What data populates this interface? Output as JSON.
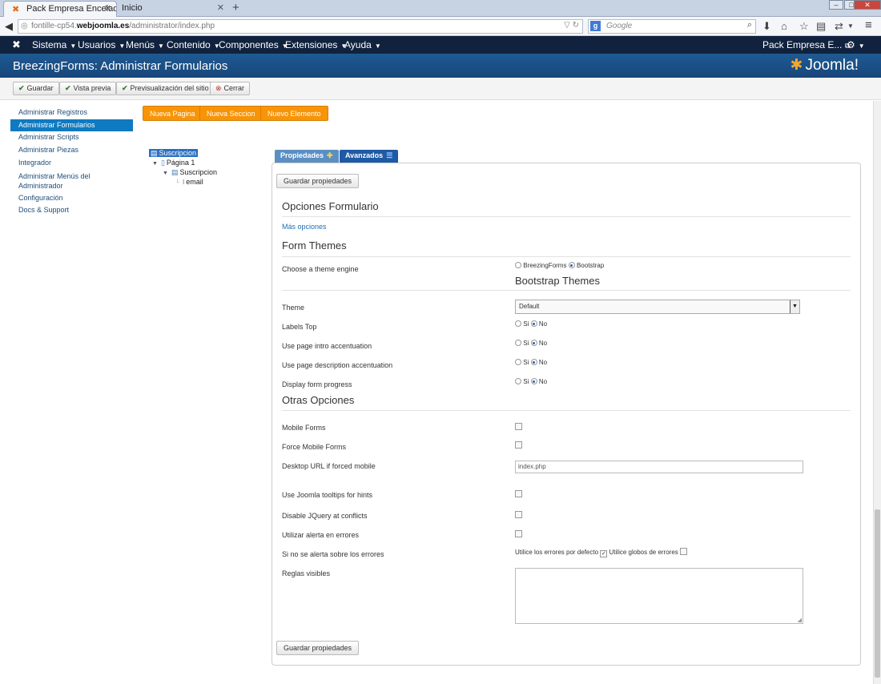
{
  "browser": {
    "tabs": [
      {
        "title": "Pack Empresa Encelado - A...",
        "active": true
      },
      {
        "title": "Inicio",
        "active": false
      }
    ],
    "new_tab": "+",
    "url_prefix": "fontille-cp54.",
    "url_domain": "webjoomla.es",
    "url_suffix": "/administrator/index.php",
    "search_placeholder": "Google",
    "search_engine_letter": "g"
  },
  "joomla_menu": {
    "items": [
      "Sistema",
      "Usuarios",
      "Menús",
      "Contenido",
      "Componentes",
      "Extensiones",
      "Ayuda"
    ],
    "site_link": "Pack Empresa E...",
    "gear": "⚙"
  },
  "header": {
    "title": "BreezingForms: Administrar Formularios",
    "brand": "Joomla!"
  },
  "toolbar": {
    "save": "Guardar",
    "preview": "Vista previa",
    "site_preview": "Previsualización del sitio",
    "close": "Cerrar"
  },
  "sidebar": {
    "items": [
      "Administrar Registros",
      "Administrar Formularios",
      "Administrar Scripts",
      "Administrar Piezas",
      "Integrador",
      "Administrar Menús del Administrador",
      "Configuración",
      "Docs & Support"
    ],
    "active_index": 1
  },
  "actions": {
    "new_page": "Nueva Pagina",
    "new_section": "Nueva Seccion",
    "new_element": "Nuevo Elemento"
  },
  "tree": {
    "root": "Suscripcion",
    "page": "Página 1",
    "section": "Suscripcion",
    "element": "email"
  },
  "tabs": {
    "properties": "Propiedades",
    "advanced": "Avanzados"
  },
  "panel": {
    "save_properties": "Guardar propiedades",
    "form_options_title": "Opciones Formulario",
    "more_options": "Más opciones",
    "form_themes_title": "Form Themes",
    "theme_engine_label": "Choose a theme engine",
    "theme_engine_options": [
      "BreezingForms",
      "Bootstrap"
    ],
    "theme_engine_selected": "Bootstrap",
    "bootstrap_themes_title": "Bootstrap Themes",
    "theme_label": "Theme",
    "theme_value": "Default",
    "yes": "Si",
    "no": "No",
    "labels_top": "Labels Top",
    "intro_accentuation": "Use page intro accentuation",
    "description_accentuation": "Use page description accentuation",
    "form_progress": "Display form progress",
    "other_options_title": "Otras Opciones",
    "mobile_forms": "Mobile Forms",
    "force_mobile_forms": "Force Mobile Forms",
    "desktop_url_label": "Desktop URL if forced mobile",
    "desktop_url_value": "index.php",
    "joomla_tooltips": "Use Joomla tooltips for hints",
    "disable_jquery": "Disable JQuery at conflicts",
    "error_alert": "Utilizar alerta en errores",
    "no_alert_label": "Si no se alerta sobre los errores",
    "default_errors": "Utilice los errores por defecto",
    "global_errors": "Utilice globos de errores",
    "visible_rules": "Reglas visibles"
  }
}
